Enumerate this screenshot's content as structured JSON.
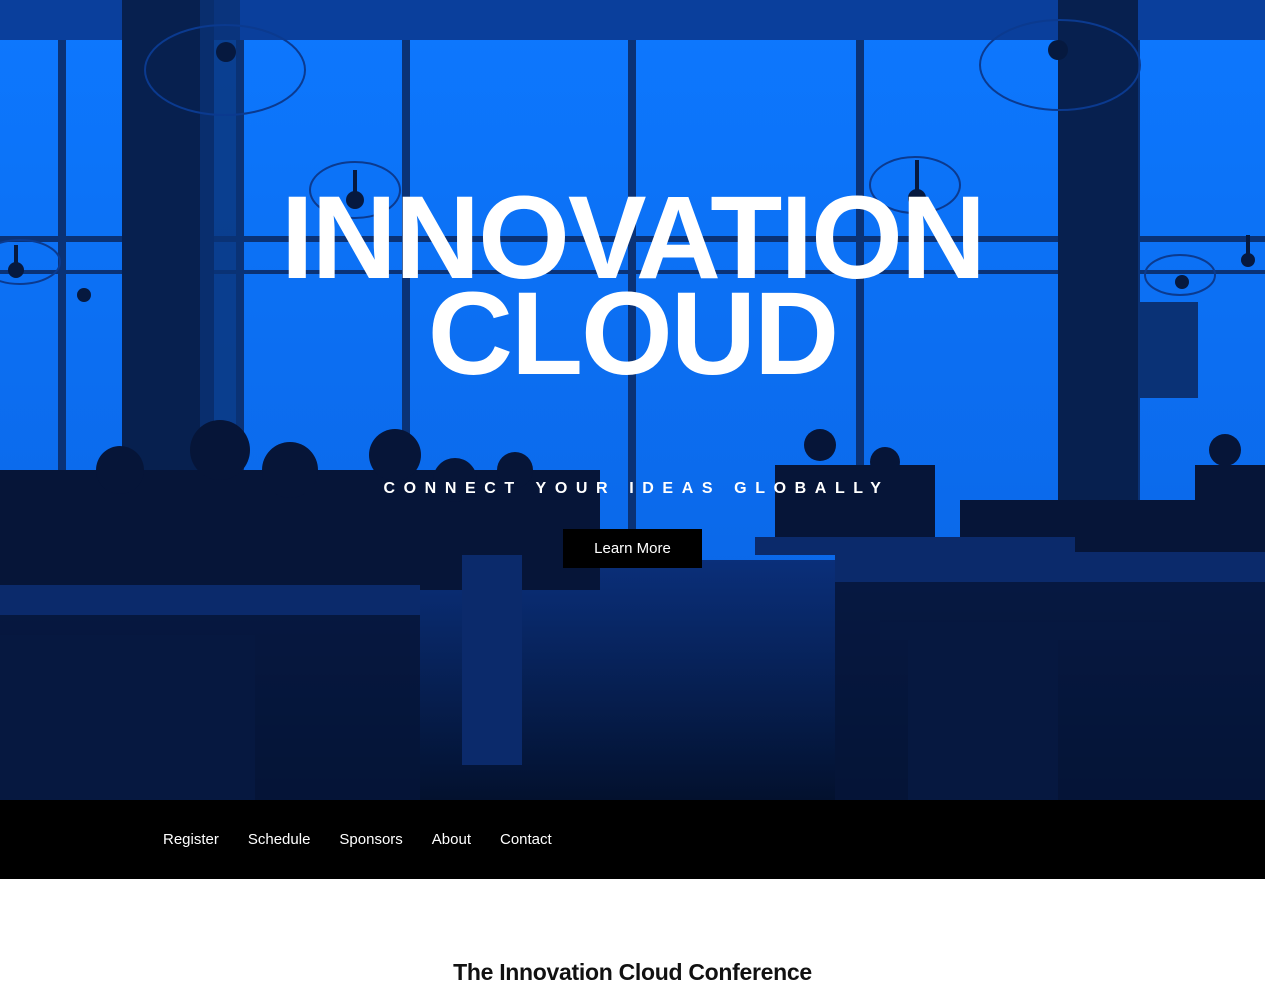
{
  "hero": {
    "title_line1": "INNOVATION",
    "title_line2": "CLOUD",
    "subtitle": "CONNECT YOUR IDEAS GLOBALLY",
    "button_label": "Learn More",
    "tint_color": "#0a6ef2",
    "shadow_color": "#06193f"
  },
  "nav": {
    "items": [
      {
        "label": "Register"
      },
      {
        "label": "Schedule"
      },
      {
        "label": "Sponsors"
      },
      {
        "label": "About"
      },
      {
        "label": "Contact"
      }
    ]
  },
  "intro": {
    "title": "The Innovation Cloud Conference"
  }
}
